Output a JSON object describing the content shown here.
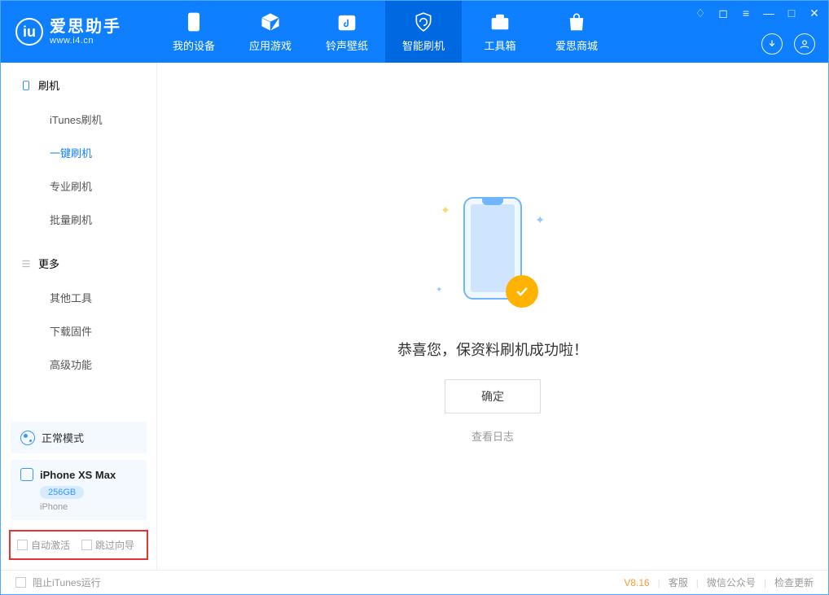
{
  "app": {
    "name": "爱思助手",
    "site": "www.i4.cn"
  },
  "nav": {
    "device": "我的设备",
    "apps": "应用游戏",
    "ringtones": "铃声壁纸",
    "flash": "智能刷机",
    "toolbox": "工具箱",
    "store": "爱思商城"
  },
  "sidebar": {
    "section1": {
      "title": "刷机",
      "items": [
        "iTunes刷机",
        "一键刷机",
        "专业刷机",
        "批量刷机"
      ]
    },
    "section2": {
      "title": "更多",
      "items": [
        "其他工具",
        "下载固件",
        "高级功能"
      ]
    },
    "status": "正常模式",
    "device": {
      "name": "iPhone XS Max",
      "capacity": "256GB",
      "type": "iPhone"
    },
    "options": {
      "auto_activate": "自动激活",
      "skip_guide": "跳过向导"
    }
  },
  "main": {
    "success_text": "恭喜您，保资料刷机成功啦！",
    "ok_button": "确定",
    "view_log": "查看日志"
  },
  "footer": {
    "stop_itunes": "阻止iTunes运行",
    "version": "V8.16",
    "support": "客服",
    "wechat": "微信公众号",
    "update": "检查更新"
  }
}
